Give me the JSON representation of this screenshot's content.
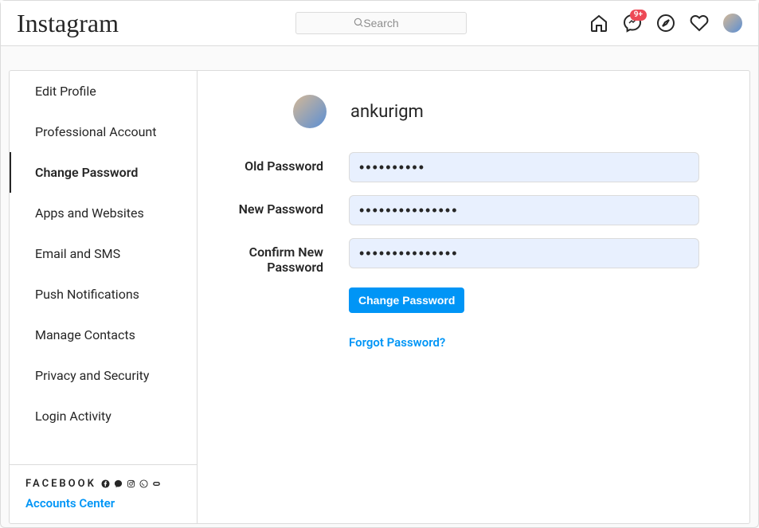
{
  "header": {
    "logo_text": "Instagram",
    "search_placeholder": "Search",
    "badge_count": "9+"
  },
  "sidebar": {
    "items": [
      {
        "label": "Edit Profile",
        "active": false
      },
      {
        "label": "Professional Account",
        "active": false
      },
      {
        "label": "Change Password",
        "active": true
      },
      {
        "label": "Apps and Websites",
        "active": false
      },
      {
        "label": "Email and SMS",
        "active": false
      },
      {
        "label": "Push Notifications",
        "active": false
      },
      {
        "label": "Manage Contacts",
        "active": false
      },
      {
        "label": "Privacy and Security",
        "active": false
      },
      {
        "label": "Login Activity",
        "active": false
      }
    ],
    "footer_brand": "FACEBOOK",
    "accounts_center": "Accounts Center"
  },
  "content": {
    "username": "ankurigm",
    "fields": {
      "old_password_label": "Old Password",
      "old_password_value": "••••••••••",
      "new_password_label": "New Password",
      "new_password_value": "•••••••••••••••",
      "confirm_label_line1": "Confirm New",
      "confirm_label_line2": "Password",
      "confirm_value": "•••••••••••••••"
    },
    "submit_label": "Change Password",
    "forgot_label": "Forgot Password?"
  }
}
